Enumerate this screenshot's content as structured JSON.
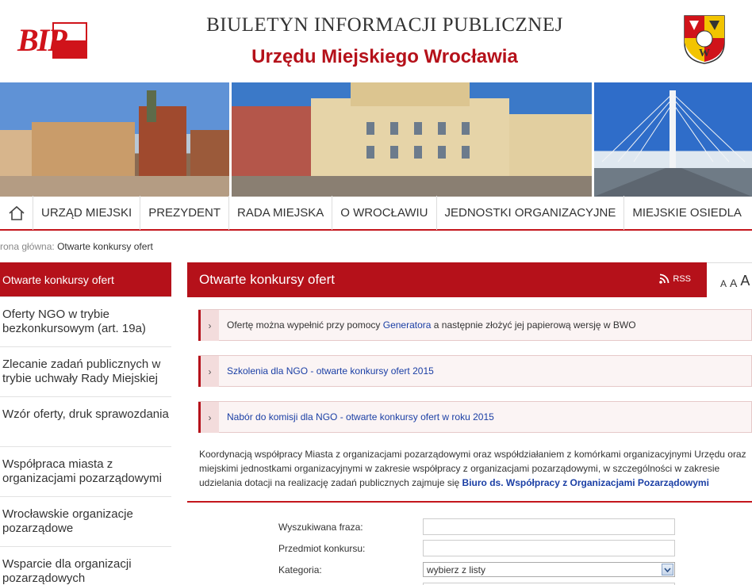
{
  "header": {
    "logo_text": "BIP",
    "title": "BIULETYN INFORMACJI PUBLICZNEJ",
    "subtitle": "Urzędu Miejskiego Wrocławia"
  },
  "nav": {
    "items": [
      "URZĄD MIEJSKI",
      "PREZYDENT",
      "RADA MIEJSKA",
      "O WROCŁAWIU",
      "JEDNOSTKI ORGANIZACYJNE",
      "MIEJSKIE OSIEDLA"
    ]
  },
  "breadcrumb": {
    "prefix": "rona główna:",
    "current": "Otwarte konkursy ofert"
  },
  "sidebar": {
    "items": [
      "Otwarte konkursy ofert",
      "Oferty NGO w trybie bezkonkursowym (art. 19a)",
      "Zlecanie zadań publicznych w trybie uchwały Rady Miejskiej",
      "Wzór oferty, druk sprawozdania",
      "Współpraca miasta z organizacjami pozarządowymi",
      "Wrocławskie organizacje pozarządowe",
      "Wsparcie dla organizacji pozarządowych"
    ]
  },
  "main": {
    "title": "Otwarte konkursy ofert",
    "rss_label": "RSS",
    "font_sizes": [
      "A",
      "A",
      "A"
    ],
    "notice1": {
      "before": "Ofertę można wypełnić przy pomocy ",
      "link": "Generatora",
      "after": " a następnie złożyć jej papierową wersję w BWO"
    },
    "notice2": "Szkolenia dla NGO - otwarte konkursy ofert 2015",
    "notice3": "Nabór do komisji dla NGO - otwarte konkursy ofert w roku 2015",
    "coord_text": "Koordynacją współpracy Miasta z organizacjami pozarządowymi oraz współdziałaniem z komórkami organizacyjnymi Urzędu oraz miejskimi jednostkami organizacyjnymi w zakresie współpracy z organizacjami pozarządowymi, w szczególności w zakresie udzielania dotacji na realizację zadań publicznych zajmuje się ",
    "coord_link": "Biuro ds. Współpracy z Organizacjami Pozarządowymi"
  },
  "form": {
    "phrase_label": "Wyszukiwana fraza:",
    "phrase_value": "",
    "subject_label": "Przedmiot konkursu:",
    "subject_value": "",
    "category_label": "Kategoria:",
    "category_value": "wybierz z listy"
  },
  "colors": {
    "accent": "#b5111a",
    "link": "#1b3fa5"
  }
}
